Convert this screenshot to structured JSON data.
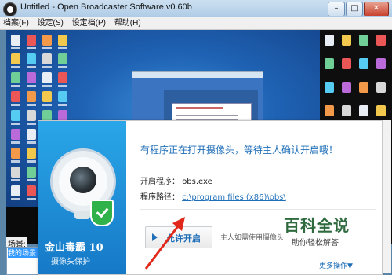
{
  "window": {
    "title": "Untitled - Open Broadcaster Software v0.60b",
    "minimize_glyph": "–",
    "maximize_glyph": "□",
    "close_glyph": "✕"
  },
  "menu": {
    "items": [
      {
        "label": "档案(F)"
      },
      {
        "label": "设定(S)"
      },
      {
        "label": "设定档(P)"
      },
      {
        "label": "帮助(H)"
      }
    ]
  },
  "scenes": {
    "label": "场景:",
    "selected": "我的场景"
  },
  "popup": {
    "brand": "金山毒霸 10",
    "brand_sub": "摄像头保护",
    "headline": "有程序正在打开摄像头，等待主人确认开启哦！",
    "program_label": "开启程序：",
    "program_value": "obs.exe",
    "path_label": "程序路径：",
    "path_value": "c:\\program files (x86)\\obs\\",
    "allow_button": "允许开启",
    "hint": "主人如需使用摄像头",
    "more_ops": "更多操作▼"
  },
  "watermark": {
    "main": "百科全说",
    "sub": "助你轻松解答"
  },
  "colors": {
    "accent": "#1f6fb8",
    "popup_side": "#1679c7",
    "shield": "#2fb24a"
  }
}
